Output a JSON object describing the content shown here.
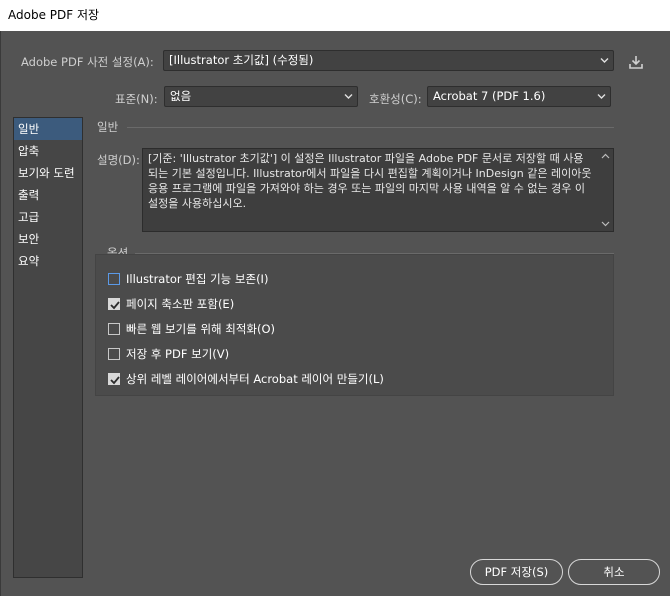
{
  "window": {
    "title": "Adobe PDF 저장"
  },
  "preset": {
    "label": "Adobe PDF 사전 설정(A):",
    "value": "[Illustrator 초기값] (수정됨)"
  },
  "standard": {
    "label": "표준(N):",
    "value": "없음"
  },
  "compat": {
    "label": "호환성(C):",
    "value": "Acrobat 7 (PDF 1.6)"
  },
  "sidebar": {
    "items": [
      {
        "label": "일반",
        "active": true
      },
      {
        "label": "압축"
      },
      {
        "label": "보기와 도련"
      },
      {
        "label": "출력"
      },
      {
        "label": "고급"
      },
      {
        "label": "보안"
      },
      {
        "label": "요약"
      }
    ]
  },
  "general": {
    "title": "일반",
    "desc_label": "설명(D):",
    "description": "[기준: 'Illustrator 초기값'] 이 설정은 Illustrator 파일을 Adobe PDF 문서로 저장할 때 사용되는 기본 설정입니다. Illustrator에서 파일을 다시 편집할 계획이거나 InDesign 같은 레이아웃 응용 프로그램에 파일을 가져와야 하는 경우 또는 파일의 마지막 사용 내역을 알 수 없는 경우 이 설정을 사용하십시오."
  },
  "options": {
    "title": "옵션",
    "items": [
      {
        "label": "Illustrator 편집 기능 보존(I)",
        "checked": false
      },
      {
        "label": "페이지 축소판 포함(E)",
        "checked": true
      },
      {
        "label": "빠른 웹 보기를 위해 최적화(O)",
        "checked": false
      },
      {
        "label": "저장 후 PDF 보기(V)",
        "checked": false
      },
      {
        "label": "상위 레벨 레이어에서부터 Acrobat 레이어 만들기(L)",
        "checked": true
      }
    ]
  },
  "buttons": {
    "save": "PDF 저장(S)",
    "cancel": "취소"
  },
  "colors": {
    "accent": "#3c5b7d",
    "background": "#535353",
    "focus": "#5b9ae8"
  }
}
